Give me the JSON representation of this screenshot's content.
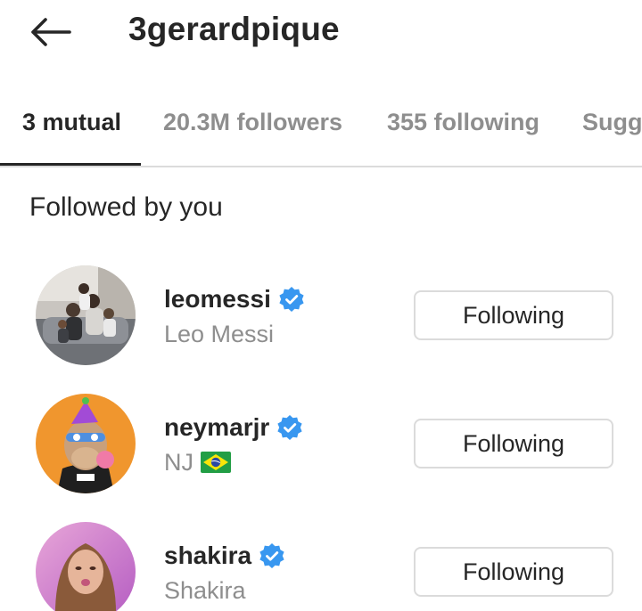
{
  "header": {
    "back_icon": "arrow-left-icon",
    "title": "3gerardpique"
  },
  "tabs": [
    {
      "label": "3 mutual",
      "active": true
    },
    {
      "label": "20.3M followers",
      "active": false
    },
    {
      "label": "355 following",
      "active": false
    },
    {
      "label": "Sugge",
      "active": false
    }
  ],
  "section": {
    "title": "Followed by you"
  },
  "accounts": [
    {
      "username": "leomessi",
      "full_name": "Leo Messi",
      "verified": true,
      "button_label": "Following"
    },
    {
      "username": "neymarjr",
      "full_name": "NJ",
      "flag_icon": "brazil-flag-icon",
      "verified": true,
      "button_label": "Following"
    },
    {
      "username": "shakira",
      "full_name": "Shakira",
      "verified": true,
      "button_label": "Following"
    }
  ],
  "colors": {
    "text_primary": "#262626",
    "text_secondary": "#8e8e8e",
    "border": "#dbdbdb",
    "verified_blue": "#3897f0"
  }
}
